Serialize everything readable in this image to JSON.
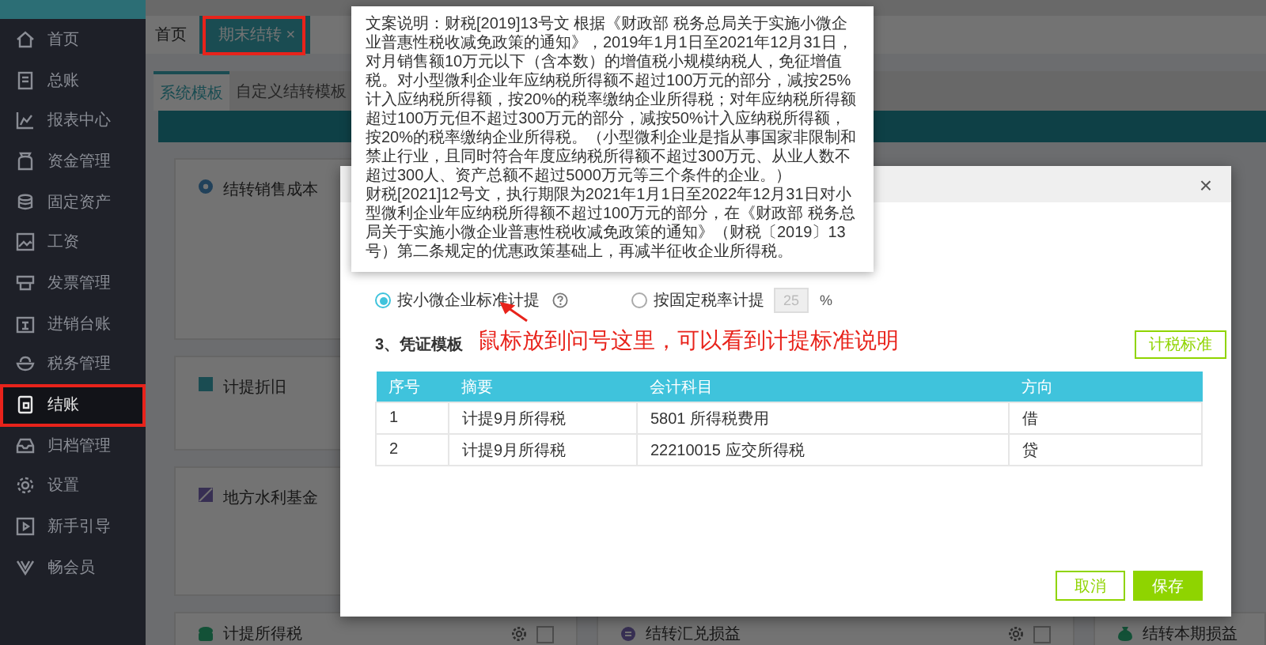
{
  "sidebar": {
    "items": [
      {
        "label": "首页",
        "selected": false
      },
      {
        "label": "总账",
        "selected": false
      },
      {
        "label": "报表中心",
        "selected": false
      },
      {
        "label": "资金管理",
        "selected": false
      },
      {
        "label": "固定资产",
        "selected": false
      },
      {
        "label": "工资",
        "selected": false
      },
      {
        "label": "发票管理",
        "selected": false
      },
      {
        "label": "进销台账",
        "selected": false
      },
      {
        "label": "税务管理",
        "selected": false
      },
      {
        "label": "结账",
        "selected": true
      },
      {
        "label": "归档管理",
        "selected": false
      },
      {
        "label": "设置",
        "selected": false
      },
      {
        "label": "新手引导",
        "selected": false
      },
      {
        "label": "畅会员",
        "selected": false
      }
    ]
  },
  "tabs": [
    {
      "label": "首页",
      "selected": false
    },
    {
      "label": "期末结转",
      "selected": true,
      "close_glyph": "×"
    }
  ],
  "subtabs": [
    {
      "label": "系统模板",
      "selected": true
    },
    {
      "label": "自定义结转模板",
      "selected": false
    }
  ],
  "cards": [
    {
      "title": "结转销售成本"
    },
    {
      "title": "计提折旧"
    },
    {
      "title": "地方水利基金"
    },
    {
      "title": "计提所得税",
      "checked": false
    },
    {
      "title": "结转汇兑损益",
      "checked": false
    },
    {
      "title": "结转本期损益"
    }
  ],
  "modal": {
    "close_glyph": "×",
    "radios": [
      {
        "label": "按小微企业标准计提",
        "selected": true,
        "help": true
      },
      {
        "label": "按固定税率计提",
        "selected": false
      }
    ],
    "rate_field": {
      "value": "25",
      "disabled": true
    },
    "rate_unit": "%",
    "section_title": "3、凭证模板",
    "standard_button": "计税标准",
    "table": {
      "columns": [
        "序号",
        "摘要",
        "会计科目",
        "方向"
      ],
      "rows": [
        [
          "1",
          "计提9月所得税",
          "5801 所得税费用",
          "借"
        ],
        [
          "2",
          "计提9月所得税",
          "22210015 应交所得税",
          "贷"
        ]
      ]
    },
    "buttons": [
      {
        "label": "取消",
        "kind": "secondary"
      },
      {
        "label": "保存",
        "kind": "primary"
      }
    ]
  },
  "tooltip": {
    "paragraphs": [
      "文案说明：财税[2019]13号文 根据《财政部 税务总局关于实施小微企业普惠性税收减免政策的通知》，2019年1月1日至2021年12月31日，对月销售额10万元以下（含本数）的增值税小规模纳税人，免征增值税。对小型微利企业年应纳税所得额不超过100万元的部分，减按25%计入应纳税所得额，按20%的税率缴纳企业所得税；对年应纳税所得额超过100万元但不超过300万元的部分，减按50%计入应纳税所得额，按20%的税率缴纳企业所得税。（小型微利企业是指从事国家非限制和禁止行业，且同时符合年度应纳税所得额不超过300万元、从业人数不超过300人、资产总额不超过5000万元等三个条件的企业。）",
      "财税[2021]12号文，执行期限为2021年1月1日至2022年12月31日对小型微利企业年应纳税所得额不超过100万元的部分，在《财政部 税务总局关于实施小微企业普惠性税收减免政策的通知》（财税〔2019〕13号）第二条规定的优惠政策基础上，再减半征收企业所得税。"
    ]
  },
  "annotation": {
    "text": "鼠标放到问号这里，可以看到计提标准说明"
  }
}
